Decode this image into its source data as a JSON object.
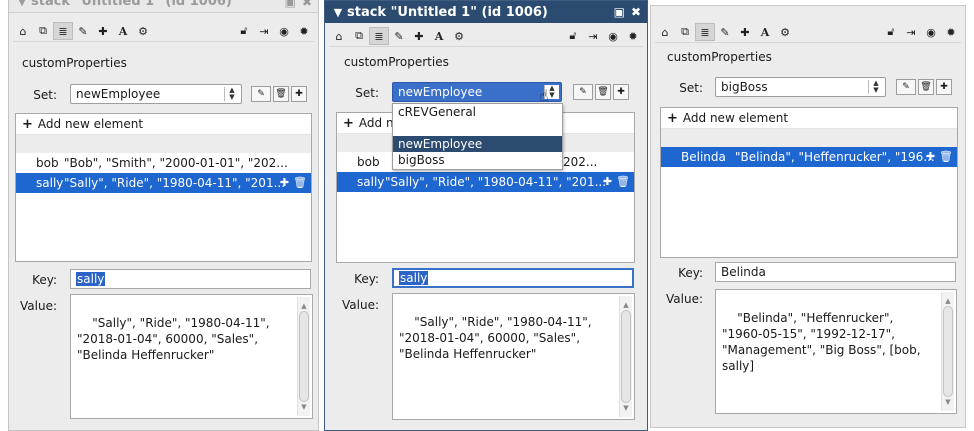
{
  "colors": {
    "active_titlebar": "#2b4c70",
    "selection": "#1e66d0",
    "panel_bg": "#ececec"
  },
  "toolbar_icons": [
    "home-icon",
    "copy-icon",
    "database-icon",
    "pencil-icon",
    "move-icon",
    "text-icon",
    "gears-icon",
    "lock-icon",
    "exit-icon",
    "target-icon",
    "settings-icon"
  ],
  "panel1": {
    "title": "stack \"Untitled 1\" (id 1006)",
    "heading": "customProperties",
    "set_label": "Set:",
    "set_value": "newEmployee",
    "add_label": "Add new element",
    "rows": [
      {
        "name": "bob",
        "values": "\"Bob\", \"Smith\", \"2000-01-01\", \"202..."
      },
      {
        "name": "sally",
        "values": "\"Sally\", \"Ride\", \"1980-04-11\", \"201..."
      }
    ],
    "key_label": "Key:",
    "key_value": "sally",
    "value_label": "Value:",
    "value_text": "\"Sally\", \"Ride\", \"1980-04-11\",\n\"2018-01-04\", 60000, \"Sales\",\n\"Belinda Heffenrucker\""
  },
  "panel2": {
    "title": "stack \"Untitled 1\" (id 1006)",
    "heading": "customProperties",
    "set_label": "Set:",
    "set_value": "newEmployee",
    "add_label": "Add n",
    "dropdown_options": [
      "cREVGeneral",
      "",
      "newEmployee",
      "bigBoss"
    ],
    "rows": [
      {
        "name": "bob",
        "values": "202..."
      },
      {
        "name": "sally",
        "values": "\"Sally\", \"Ride\", \"1980-04-11\", \"201..."
      }
    ],
    "key_label": "Key:",
    "key_value": "sally",
    "value_label": "Value:",
    "value_text": "\"Sally\", \"Ride\", \"1980-04-11\",\n\"2018-01-04\", 60000, \"Sales\",\n\"Belinda Heffenrucker\""
  },
  "panel3": {
    "heading": "customProperties",
    "set_label": "Set:",
    "set_value": "bigBoss",
    "add_label": "Add new element",
    "rows": [
      {
        "name": "Belinda",
        "values": "\"Belinda\", \"Heffenrucker\", \"196..."
      }
    ],
    "key_label": "Key:",
    "key_value": "Belinda",
    "value_label": "Value:",
    "value_text": "\"Belinda\", \"Heffenrucker\",\n\"1960-05-15\", \"1992-12-17\",\n\"Management\", \"Big Boss\", [bob,\nsally]"
  }
}
